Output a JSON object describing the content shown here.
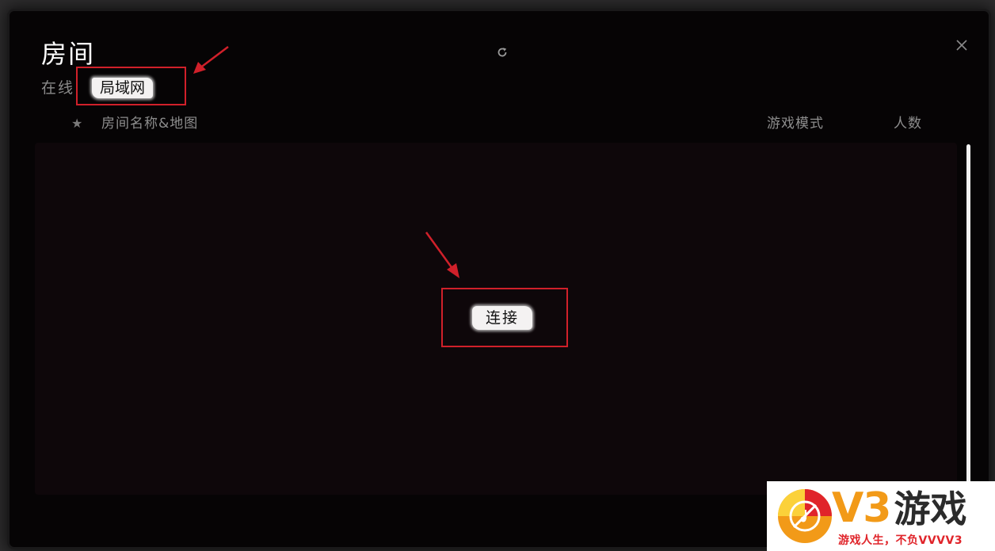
{
  "window": {
    "title": "房间",
    "refresh_icon": "refresh-icon",
    "close_icon": "close-icon"
  },
  "tabs": [
    {
      "label": "在线",
      "selected": false
    },
    {
      "label": "局域网",
      "selected": true
    }
  ],
  "table": {
    "favorite_icon": "star-icon",
    "columns": [
      "房间名称&地图",
      "游戏模式",
      "人数"
    ],
    "rows": []
  },
  "actions": {
    "connect_label": "连接"
  },
  "annotations": {
    "highlight_color": "#d0202a"
  },
  "watermark": {
    "brand": "V3",
    "brand_cn": "游戏",
    "slogan": "游戏人生，不负VVVV3",
    "colors": {
      "orange": "#f29a18",
      "red": "#e0242a"
    }
  }
}
